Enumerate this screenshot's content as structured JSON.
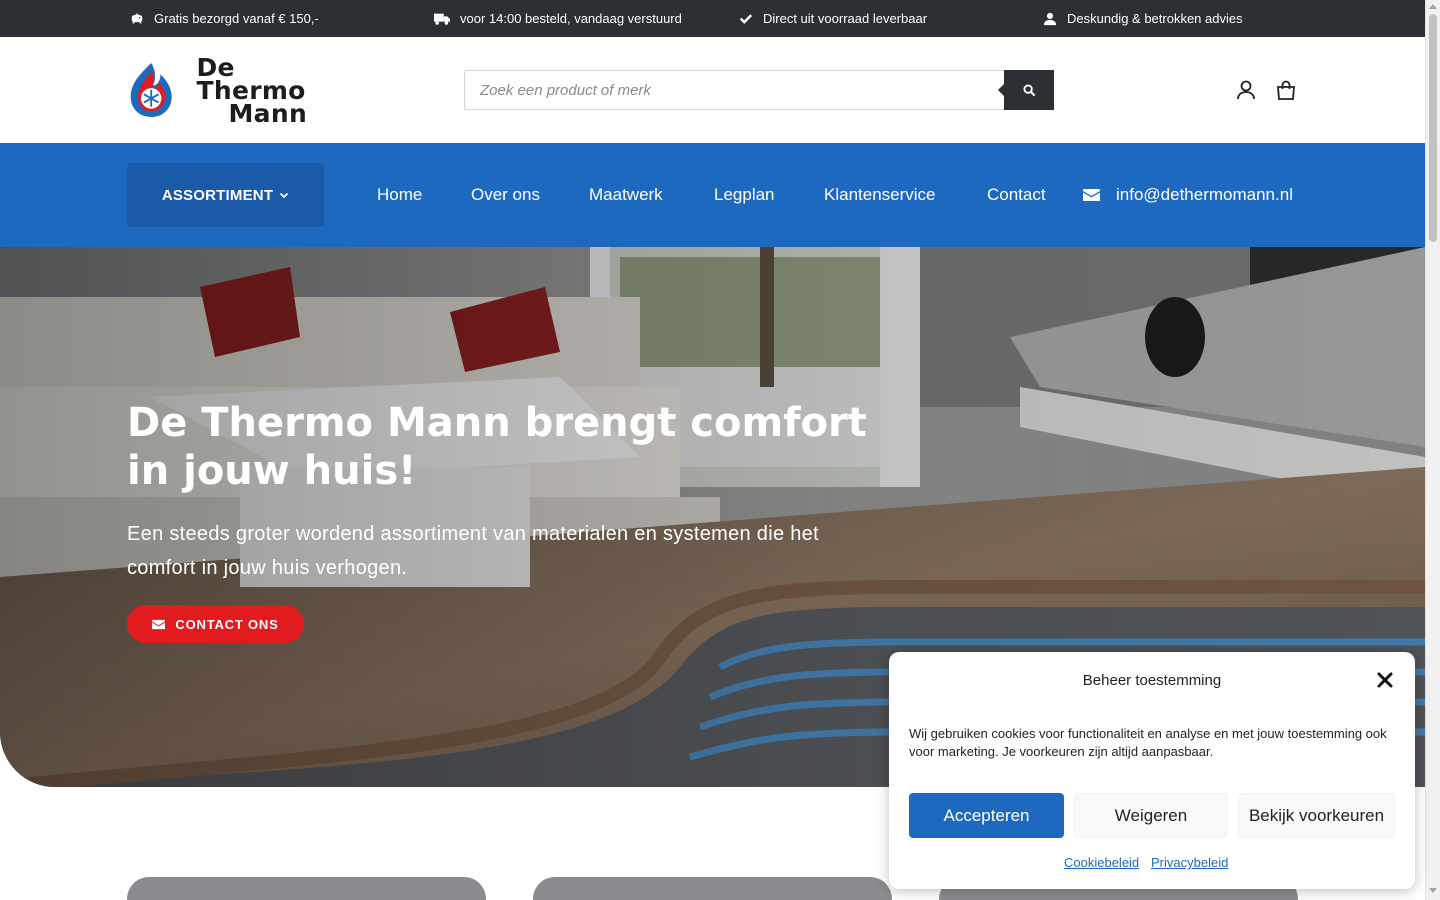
{
  "colors": {
    "topbar_bg": "#2c2f33",
    "nav_blue": "#1e69c0",
    "nav_assortment_bg": "#1a5aa8",
    "cta_red": "#e21b1f",
    "accept_blue": "#1e69c0"
  },
  "topbar": {
    "items": [
      {
        "icon": "piggy-bank-icon",
        "text": "Gratis bezorgd vanaf € 150,-"
      },
      {
        "icon": "truck-icon",
        "text": "voor 14:00 besteld, vandaag verstuurd"
      },
      {
        "icon": "check-icon",
        "text": "Direct uit voorraad leverbaar"
      },
      {
        "icon": "user-icon",
        "text": "Deskundig & betrokken advies"
      }
    ]
  },
  "header": {
    "logo_line1": "De Thermo",
    "logo_line2": "Mann",
    "search_placeholder": "Zoek een product of merk",
    "search_icon": "search-icon",
    "account_icon": "user-icon",
    "cart_icon": "shopping-bag-icon"
  },
  "nav": {
    "assortment_label": "ASSORTIMENT",
    "links": [
      "Home",
      "Over ons",
      "Maatwerk",
      "Legplan",
      "Klantenservice",
      "Contact"
    ],
    "email": "info@dethermomann.nl",
    "email_icon": "envelope-icon"
  },
  "hero": {
    "title": "De Thermo Mann brengt comfort in jouw huis!",
    "subtitle": "Een steeds groter wordend assortiment van materialen en systemen die het comfort in jouw huis verhogen.",
    "cta_label": "CONTACT ONS",
    "cta_icon": "envelope-icon"
  },
  "cookie": {
    "title": "Beheer toestemming",
    "text": "Wij gebruiken cookies voor functionaliteit en analyse en met jouw toestemming ook voor marketing. Je voorkeuren zijn altijd aanpasbaar.",
    "accept": "Accepteren",
    "deny": "Weigeren",
    "preferences": "Bekijk voorkeuren",
    "cookie_policy": "Cookiebeleid",
    "privacy_policy": "Privacybeleid"
  }
}
